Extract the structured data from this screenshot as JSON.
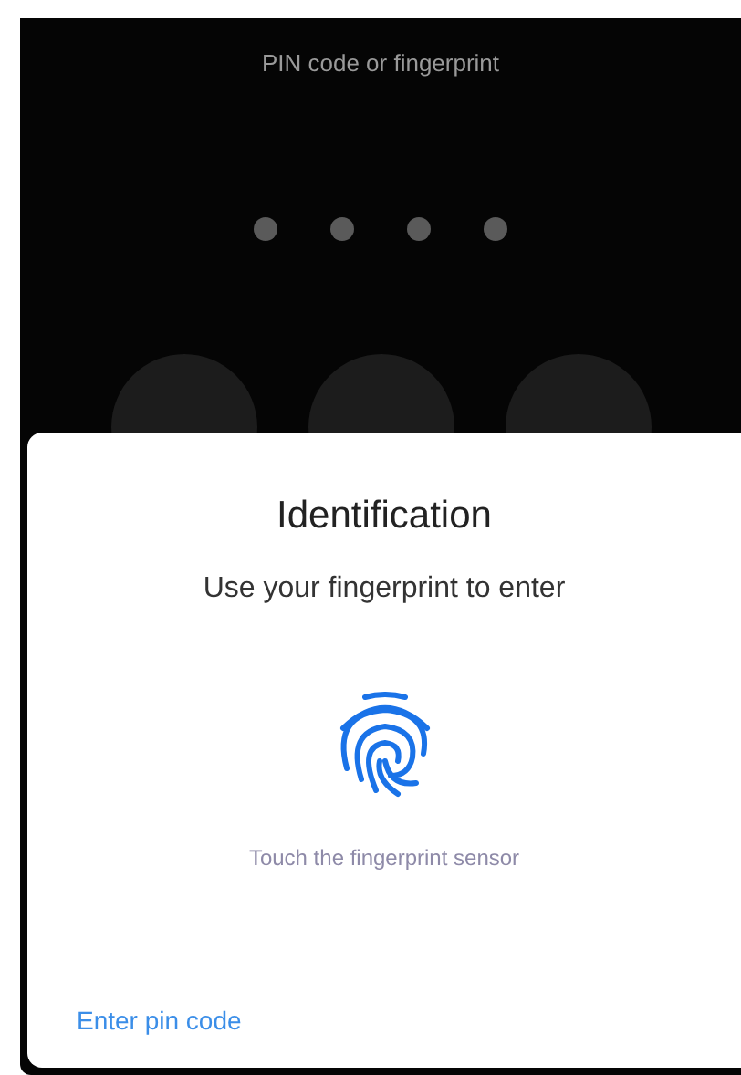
{
  "lock_screen": {
    "title": "PIN code or fingerprint",
    "pin_dots": [
      {
        "filled": true
      },
      {
        "filled": true
      },
      {
        "filled": true
      },
      {
        "filled": true
      }
    ],
    "keys": [
      {
        "kind": "digit"
      },
      {
        "kind": "digit"
      },
      {
        "kind": "digit"
      }
    ]
  },
  "dialog": {
    "title": "Identification",
    "subtitle": "Use your fingerprint to enter",
    "hint": "Touch the fingerprint sensor",
    "link": "Enter pin code"
  }
}
